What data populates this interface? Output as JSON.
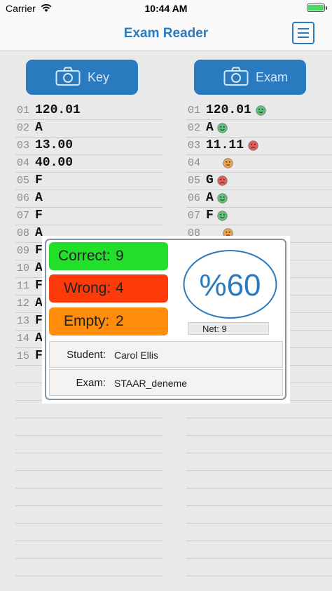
{
  "status": {
    "carrier": "Carrier",
    "time": "10:44 AM"
  },
  "nav": {
    "title": "Exam Reader"
  },
  "buttons": {
    "key_label": "Key",
    "exam_label": "Exam"
  },
  "key_rows": [
    {
      "n": "01",
      "a": "120.01"
    },
    {
      "n": "02",
      "a": "A"
    },
    {
      "n": "03",
      "a": "13.00"
    },
    {
      "n": "04",
      "a": "40.00"
    },
    {
      "n": "05",
      "a": "F"
    },
    {
      "n": "06",
      "a": "A"
    },
    {
      "n": "07",
      "a": "F"
    },
    {
      "n": "08",
      "a": "A"
    },
    {
      "n": "09",
      "a": "F"
    },
    {
      "n": "10",
      "a": "A"
    },
    {
      "n": "11",
      "a": "F"
    },
    {
      "n": "12",
      "a": "A"
    },
    {
      "n": "13",
      "a": "F"
    },
    {
      "n": "14",
      "a": "A"
    },
    {
      "n": "15",
      "a": "F"
    }
  ],
  "exam_rows": [
    {
      "n": "01",
      "a": "120.01",
      "face": "green"
    },
    {
      "n": "02",
      "a": "A",
      "face": "green"
    },
    {
      "n": "03",
      "a": "11.11",
      "face": "red"
    },
    {
      "n": "04",
      "a": "",
      "face": "orange"
    },
    {
      "n": "05",
      "a": "G",
      "face": "red"
    },
    {
      "n": "06",
      "a": "A",
      "face": "green"
    },
    {
      "n": "07",
      "a": "F",
      "face": "green"
    },
    {
      "n": "08",
      "a": "",
      "face": "orange"
    }
  ],
  "result": {
    "correct_label": "Correct:",
    "correct_value": "9",
    "wrong_label": "Wrong:",
    "wrong_value": "4",
    "empty_label": "Empty:",
    "empty_value": "2",
    "percent": "%60",
    "net": "Net: 9",
    "student_label": "Student:",
    "student_value": "Carol Ellis",
    "exam_label": "Exam:",
    "exam_value": "STAAR_deneme"
  },
  "colors": {
    "accent": "#2a7ac0",
    "correct": "#22e02a",
    "wrong": "#ff3a0a",
    "empty": "#ff8c0a",
    "face_green": "#5ec27a",
    "face_red": "#e35d5d",
    "face_orange": "#f0a24a"
  }
}
